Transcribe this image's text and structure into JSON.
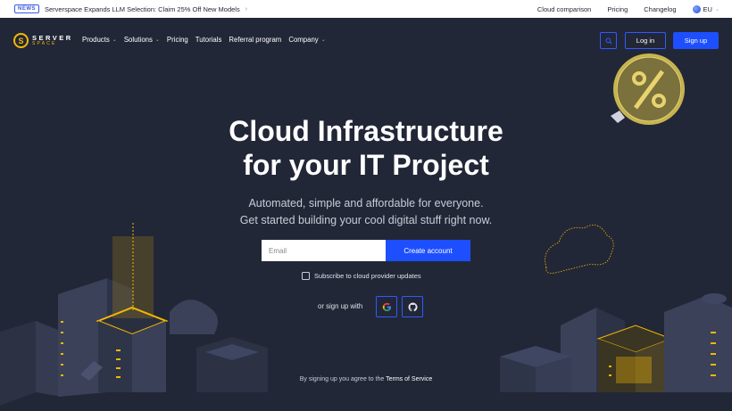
{
  "news": {
    "badge": "NEWS",
    "text": "Serverspace Expands LLM Selection: Claim 25% Off New Models",
    "arrow": "›"
  },
  "topnav": {
    "items": [
      "Cloud comparison",
      "Pricing",
      "Changelog"
    ],
    "region": "EU"
  },
  "logo": {
    "line1": "SERVER",
    "line2": "SPACE",
    "mark": "S"
  },
  "mainnav": {
    "items": [
      {
        "label": "Products",
        "dropdown": true
      },
      {
        "label": "Solutions",
        "dropdown": true
      },
      {
        "label": "Pricing",
        "dropdown": false
      },
      {
        "label": "Tutorials",
        "dropdown": false
      },
      {
        "label": "Referral program",
        "dropdown": false
      },
      {
        "label": "Company",
        "dropdown": true
      }
    ]
  },
  "header": {
    "login": "Log in",
    "signup": "Sign up"
  },
  "hero": {
    "title_line1": "Cloud Infrastructure",
    "title_line2": "for your IT Project",
    "sub_line1": "Automated, simple and affordable for everyone.",
    "sub_line2": "Get started building your cool digital stuff right now."
  },
  "form": {
    "email_placeholder": "Email",
    "create_label": "Create account",
    "subscribe_label": "Subscribe to cloud provider updates",
    "or_signup": "or sign up with"
  },
  "terms": {
    "prefix": "By signing up you agree to the ",
    "link": "Terms of Service"
  },
  "colors": {
    "bg": "#222737",
    "accent": "#1d4fff",
    "brand_yellow": "#f5b800"
  }
}
